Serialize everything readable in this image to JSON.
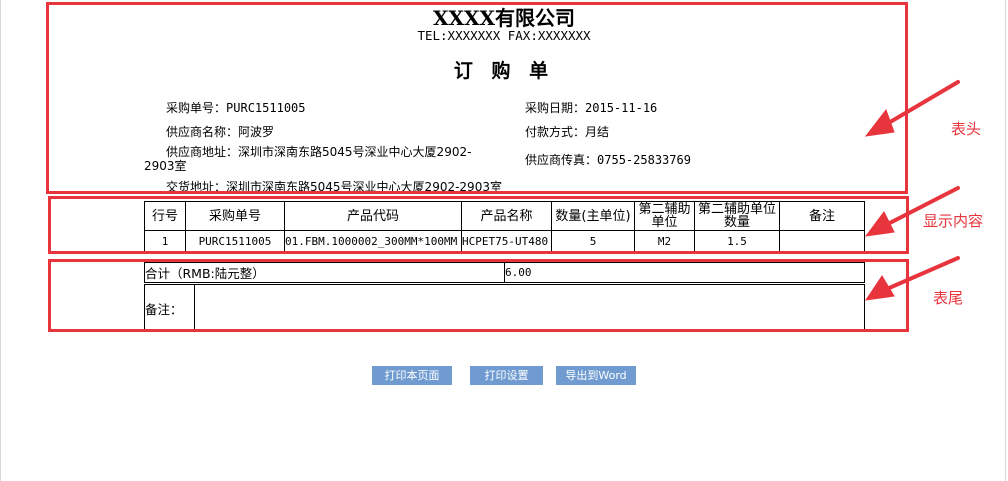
{
  "header": {
    "company": "XXXX有限公司",
    "tel_fax": "TEL:XXXXXXX  FAX:XXXXXXX",
    "title": "订 购 单",
    "fields": {
      "order_no": {
        "label": "采购单号：",
        "value": "PURC1511005"
      },
      "order_date": {
        "label": "采购日期：",
        "value": "2015-11-16"
      },
      "supplier_name": {
        "label": "供应商名称：",
        "value": "阿波罗"
      },
      "payment": {
        "label": "付款方式：",
        "value": "月结"
      },
      "supplier_addr": {
        "label": "供应商地址：",
        "value": "深圳市深南东路5045号深业中心大厦2902-",
        "value_cont": "2903室"
      },
      "supplier_fax": {
        "label": "供应商传真：",
        "value": "0755-25833769"
      },
      "delivery_addr": {
        "label": "交货地址：",
        "value": "深圳市深南东路5045号深业中心大厦2902-2903室"
      }
    }
  },
  "table": {
    "columns": [
      "行号",
      "采购单号",
      "产品代码",
      "产品名称",
      "数量(主单位)",
      "第二辅助单位",
      "第二辅助单位数量",
      "备注"
    ],
    "rows": [
      [
        "1",
        "PURC1511005",
        "01.FBM.1000002_300MM*100MM",
        "HCPET75-UT480",
        "5",
        "M2",
        "1.5",
        ""
      ]
    ]
  },
  "footer": {
    "total_label": "合计（RMB:陆元整）",
    "total_value": "6.00",
    "remark_label": "备注："
  },
  "buttons": {
    "print_page": "打印本页面",
    "print_settings": "打印设置",
    "export_word": "导出到Word"
  },
  "annotations": {
    "header": "表头",
    "content": "显示内容",
    "footer": "表尾"
  },
  "colors": {
    "annotation": "#e8343d",
    "button_bg": "#6f9bd0",
    "button_text": "#ffffff"
  }
}
